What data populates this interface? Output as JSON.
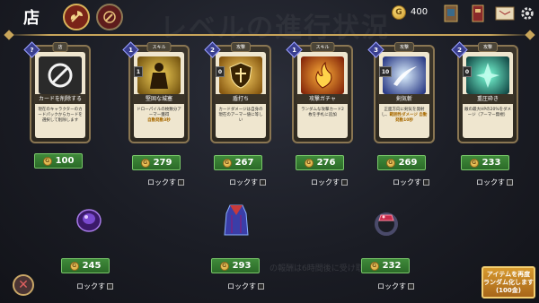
{
  "header": {
    "title": "店",
    "watermark": "レベルの進行状況",
    "gold": "400",
    "gold_symbol": "G"
  },
  "cards": [
    {
      "type": "店",
      "cost": "?",
      "side": "",
      "name": "カードを削除する",
      "desc": "現在のキャラクターのカードパックからカードを選択して削除します",
      "highlight": "",
      "price": "100",
      "lock": "",
      "art_color": "#f2f2f2"
    },
    {
      "type": "スキル",
      "cost": "1",
      "side": "1",
      "name": "堅固な城塞",
      "desc": "ドローパイルの枚数分アーマー獲得",
      "highlight": "自動発動3秒",
      "price": "279",
      "lock": "ロックす",
      "art_color": "#b8941c"
    },
    {
      "type": "攻撃",
      "cost": "2",
      "side": "0",
      "name": "盾打ち",
      "desc": "カードダメージは自身の現在のアーマー値に等しい",
      "highlight": "",
      "price": "267",
      "lock": "ロックす",
      "art_color": "#c88a10"
    },
    {
      "type": "スキル",
      "cost": "1",
      "side": "",
      "name": "攻撃ガチャ",
      "desc": "ランダムな攻撃カード2枚を手札に追加",
      "highlight": "",
      "price": "276",
      "lock": "ロックす",
      "art_color": "#c8401a"
    },
    {
      "type": "攻撃",
      "cost": "3",
      "side": "10",
      "name": "剣気斬",
      "desc": "正面方向に剣気を発射し、",
      "highlight": "範囲性ダメージ 自動発動10秒",
      "price": "269",
      "lock": "ロックす",
      "art_color": "#3a5ec8"
    },
    {
      "type": "攻撃",
      "cost": "2",
      "side": "0",
      "name": "重圧砕き",
      "desc": "敵の最大HPの20%をダメージ（アーマー無視）",
      "highlight": "",
      "price": "233",
      "lock": "ロックす",
      "art_color": "#1f7a6a"
    }
  ],
  "relics": [
    {
      "icon": "purple-gauntlet-icon",
      "price": "245",
      "lock": "ロックす"
    },
    {
      "icon": "cloak-icon",
      "price": "293",
      "lock": "ロックす"
    },
    {
      "icon": "ruby-ring-icon",
      "price": "232",
      "lock": "ロックす"
    }
  ],
  "footer": {
    "watermark": "の報酬は6時間後に受け取れます",
    "close": "✕",
    "reroll_line1": "アイテムを再度",
    "reroll_line2": "ランダム化します",
    "reroll_line3": "(100金)"
  },
  "colors": {
    "accent_gold": "#c8a55a",
    "price_green": "#3f8a3a",
    "reroll_orange": "#d79a2e"
  }
}
